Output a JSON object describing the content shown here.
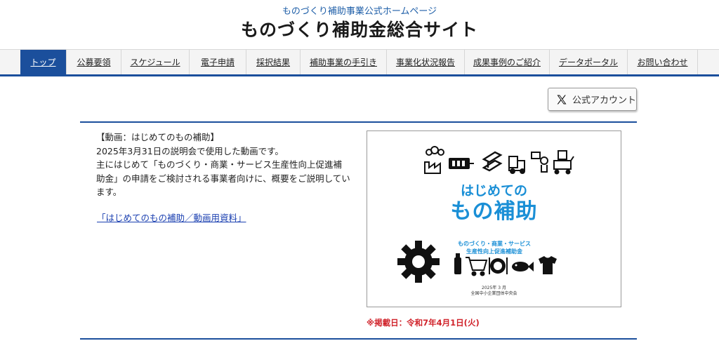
{
  "header": {
    "subtitle": "ものづくり補助事業公式ホームページ",
    "title": "ものづくり補助金総合サイト"
  },
  "nav": {
    "items": [
      {
        "label": "トップ",
        "active": true
      },
      {
        "label": "公募要領",
        "active": false
      },
      {
        "label": "スケジュール",
        "active": false
      },
      {
        "label": "電子申請",
        "active": false
      },
      {
        "label": "採択結果",
        "active": false
      },
      {
        "label": "補助事業の手引き",
        "active": false
      },
      {
        "label": "事業化状況報告",
        "active": false
      },
      {
        "label": "成果事例のご紹介",
        "active": false
      },
      {
        "label": "データポータル",
        "active": false
      },
      {
        "label": "お問い合わせ",
        "active": false
      }
    ]
  },
  "social": {
    "x_label": "公式アカウント",
    "icon": "x-logo-icon"
  },
  "article": {
    "heading": "【動画：はじめてのもの補助】",
    "line1": "2025年3月31日の説明会で使用した動画です。",
    "line2": "主にはじめて「ものづくり・商業・サービス生産性向上促進補助金」の申請をご検討される事業者向けに、概要をご説明しています。",
    "link_label": "「はじめてのもの補助／動画用資料」"
  },
  "thumbnail": {
    "title_line1": "はじめての",
    "title_line2": "もの補助",
    "sub_line1": "ものづくり・商業・サービス",
    "sub_line2": "生産性向上促進補助金",
    "date": "2025年 3 月",
    "org": "全国中小企業団体中央会",
    "accent": "#1a8fd6",
    "icons": [
      "factory-icon",
      "battery-icon",
      "steel-beam-icon",
      "forklift-icon",
      "robot-icon",
      "cart-icon",
      "gear-icon",
      "bottle-icon",
      "shopping-cart-icon",
      "plate-icon",
      "fish-icon",
      "tshirt-icon"
    ]
  },
  "posted": {
    "label": "※掲載日：令和7年4月1日(火)"
  },
  "colors": {
    "brand": "#1b4f9c",
    "link": "#1a3fb0",
    "alert": "#d0222a"
  }
}
